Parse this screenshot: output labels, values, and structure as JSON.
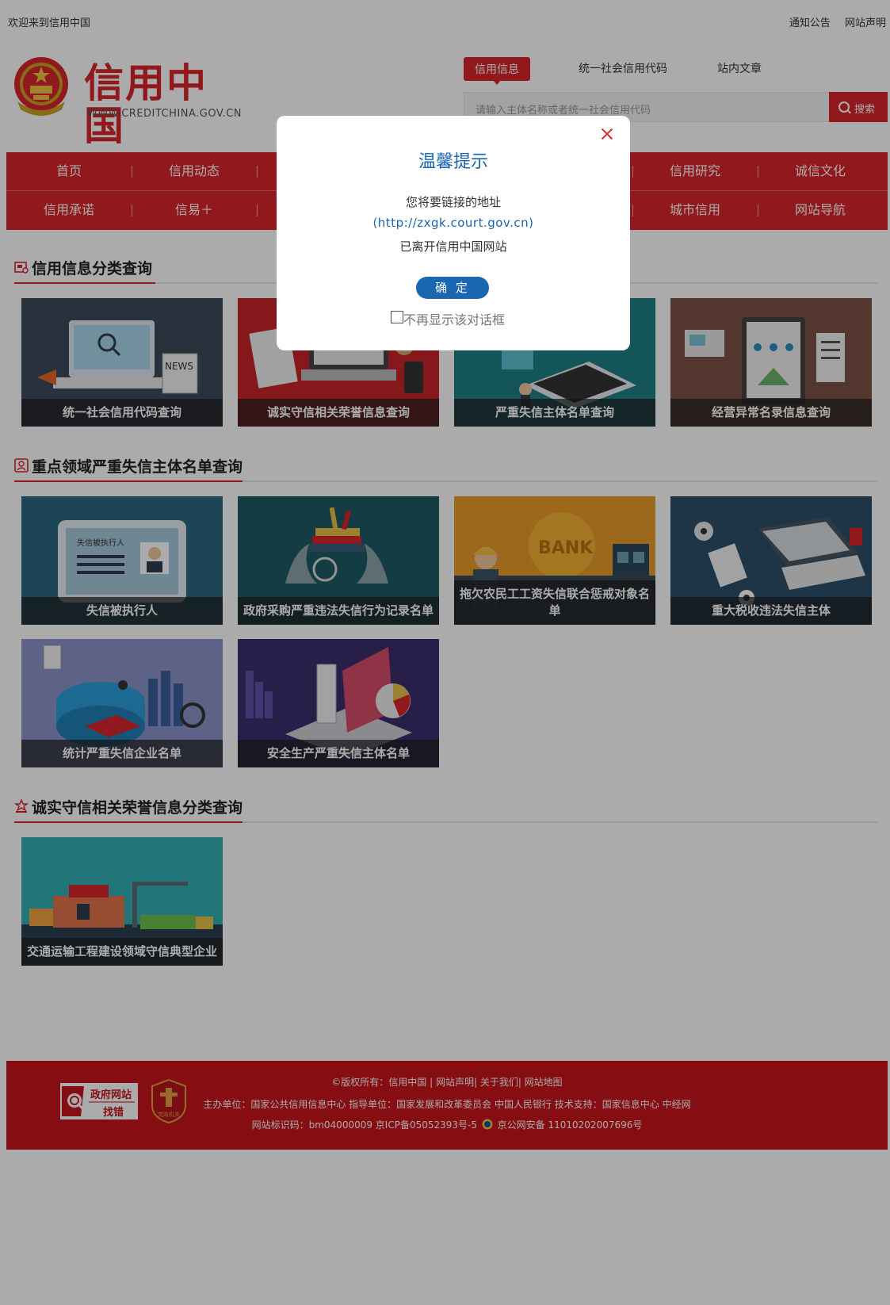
{
  "topbar": {
    "welcome": "欢迎来到信用中国",
    "notice": "通知公告",
    "statement": "网站声明"
  },
  "logo": {
    "title": "信用中国",
    "url": "WWW.CREDITCHINA.GOV.CN"
  },
  "search": {
    "tabs": [
      "信用信息",
      "统一社会信用代码",
      "站内文章"
    ],
    "active_tab": "信用信息",
    "placeholder": "请输入主体名称或者统一社会信用代码",
    "button": "搜索"
  },
  "nav": {
    "row1": [
      "首页",
      "信用动态",
      "",
      "",
      "",
      "信用研究",
      "诚信文化"
    ],
    "row2": [
      "信用承诺",
      "信易＋",
      "",
      "",
      "",
      "城市信用",
      "网站导航"
    ]
  },
  "sections": [
    {
      "title": "信用信息分类查询",
      "cards": [
        {
          "label": "统一社会信用代码查询"
        },
        {
          "label": "诚实守信相关荣誉信息查询"
        },
        {
          "label": "严重失信主体名单查询"
        },
        {
          "label": "经营异常名录信息查询"
        }
      ]
    },
    {
      "title": "重点领域严重失信主体名单查询",
      "cards": [
        {
          "label": "失信被执行人"
        },
        {
          "label": "政府采购严重违法失信行为记录名单"
        },
        {
          "label": "拖欠农民工工资失信联合惩戒对象名单"
        },
        {
          "label": "重大税收违法失信主体"
        },
        {
          "label": "统计严重失信企业名单"
        },
        {
          "label": "安全生产严重失信主体名单"
        }
      ]
    },
    {
      "title": "诚实守信相关荣誉信息分类查询",
      "cards": [
        {
          "label": "交通运输工程建设领域守信典型企业"
        }
      ]
    }
  ],
  "card_art": {
    "news_word": "NEWS",
    "bank_word": "BANK",
    "id_card_label": "失信被执行人"
  },
  "footer": {
    "line1": "©版权所有：信用中国 | 网站声明| 关于我们| 网站地图",
    "line2": "主办单位：国家公共信用信息中心   指导单位：国家发展和改革委员会 中国人民银行   技术支持：国家信息中心 中经网",
    "line3": "网站标识码：bm04000009 京ICP备05052393号-5",
    "line3b": "京公网安备 11010202007696号",
    "badge1_top": "政府网站",
    "badge1_bottom": "找错",
    "badge2_label": "党政机关"
  },
  "modal": {
    "title": "温馨提示",
    "line1": "您将要链接的地址",
    "url": "(http://zxgk.court.gov.cn)",
    "line3": "已离开信用中国网站",
    "ok": "确 定",
    "checkbox": "不再显示该对话框"
  },
  "colors": {
    "brand_red": "#d9262c",
    "modal_blue": "#1a66b0",
    "footer_red": "#c8141b"
  },
  "icons": [
    "emblem-icon",
    "search-icon",
    "close-icon",
    "section-icon",
    "gov-error-badge-icon",
    "party-badge-icon",
    "police-emblem-icon"
  ]
}
